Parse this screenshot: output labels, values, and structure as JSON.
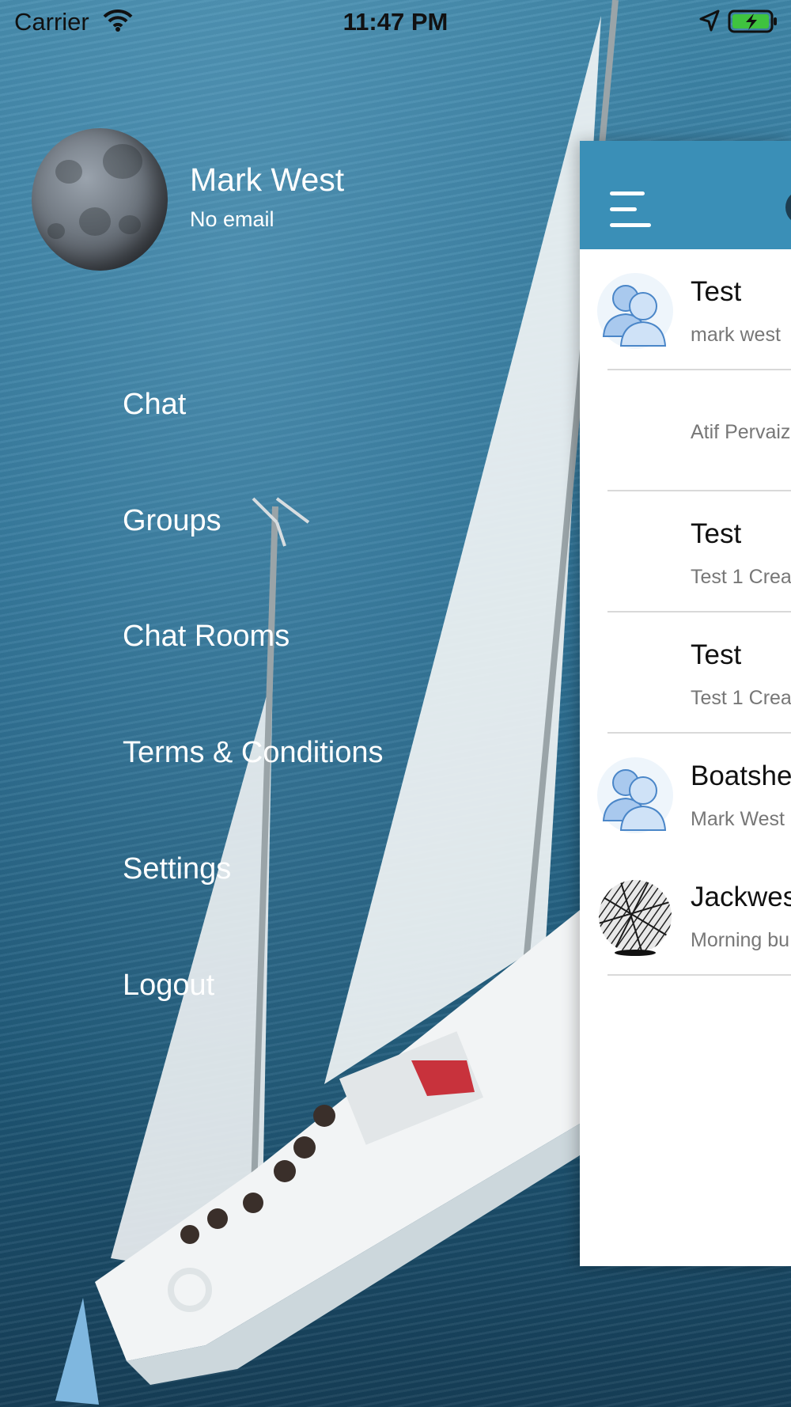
{
  "status_bar": {
    "carrier": "Carrier",
    "time": "11:47 PM",
    "icons": [
      "wifi-icon",
      "location-arrow-icon",
      "battery-charging-icon"
    ],
    "battery_color": "#3fc33f"
  },
  "drawer": {
    "profile": {
      "name": "Mark West",
      "email": "No email"
    },
    "menu": [
      {
        "label": "Chat"
      },
      {
        "label": "Groups"
      },
      {
        "label": "Chat Rooms"
      },
      {
        "label": "Terms & Conditions"
      },
      {
        "label": "Settings"
      },
      {
        "label": "Logout"
      }
    ]
  },
  "main": {
    "header_color": "#3a8fb7",
    "header_icons": [
      "hamburger-menu-icon"
    ],
    "conversations": [
      {
        "title": "Test",
        "subtitle": "mark west",
        "avatar": "group-icon"
      },
      {
        "title": "",
        "subtitle": "Atif Pervaiz",
        "avatar": ""
      },
      {
        "title": "Test",
        "subtitle": "Test 1 Crea",
        "avatar": ""
      },
      {
        "title": "Test",
        "subtitle": "Test 1 Crea",
        "avatar": ""
      },
      {
        "title": "Boatshe",
        "subtitle": "Mark West",
        "avatar": "group-icon"
      },
      {
        "title": "Jackwes",
        "subtitle": "Morning bu",
        "avatar": "pattern-avatar"
      }
    ]
  }
}
